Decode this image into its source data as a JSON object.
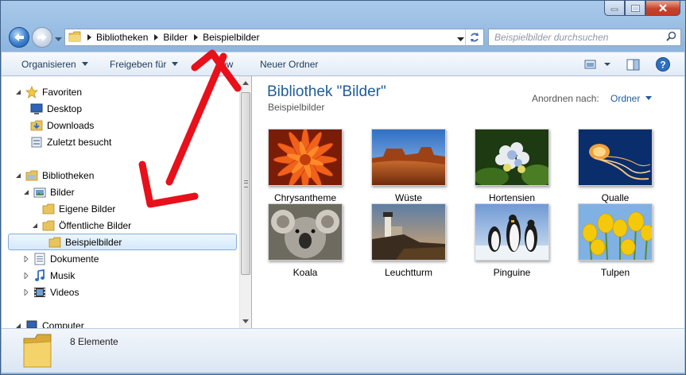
{
  "address": {
    "crumbs": [
      "Bibliotheken",
      "Bilder",
      "Beispielbilder"
    ]
  },
  "search": {
    "placeholder": "Beispielbilder durchsuchen"
  },
  "toolbar": {
    "organize": "Organisieren",
    "share": "Freigeben für",
    "slideshow": "ow",
    "new_folder": "Neuer Ordner"
  },
  "tree": {
    "favorites": "Favoriten",
    "desktop": "Desktop",
    "downloads": "Downloads",
    "recent": "Zuletzt besucht",
    "libraries": "Bibliotheken",
    "pictures": "Bilder",
    "my_pictures": "Eigene Bilder",
    "public_pictures": "Öffentliche Bilder",
    "sample_pictures": "Beispielbilder",
    "documents": "Dokumente",
    "music": "Musik",
    "videos": "Videos",
    "computer": "Computer"
  },
  "content": {
    "title": "Bibliothek \"Bilder\"",
    "subtitle": "Beispielbilder",
    "arrange_label": "Anordnen nach:",
    "arrange_value": "Ordner",
    "items": [
      {
        "label": "Chrysantheme"
      },
      {
        "label": "Wüste"
      },
      {
        "label": "Hortensien"
      },
      {
        "label": "Qualle"
      },
      {
        "label": "Koala"
      },
      {
        "label": "Leuchtturm"
      },
      {
        "label": "Pinguine"
      },
      {
        "label": "Tulpen"
      }
    ]
  },
  "status": {
    "count": "8 Elemente"
  },
  "colors": {
    "accent": "#1e5d9a",
    "annotation": "#e8101a"
  }
}
